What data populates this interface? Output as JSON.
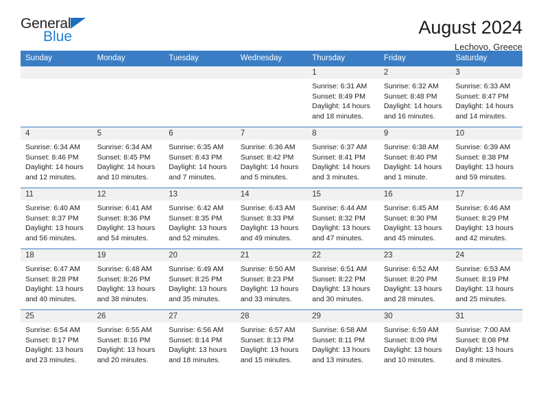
{
  "brand": {
    "word1": "General",
    "word2": "Blue",
    "flag_color": "#1f6fc0",
    "blue_color": "#1f7fd4"
  },
  "header": {
    "title": "August 2024",
    "subtitle": "Lechovo, Greece"
  },
  "theme": {
    "header_blue": "#3b7dc4",
    "daynum_band": "#f1f1f1",
    "text": "#222222"
  },
  "weekday_headers": [
    "Sunday",
    "Monday",
    "Tuesday",
    "Wednesday",
    "Thursday",
    "Friday",
    "Saturday"
  ],
  "weeks": [
    [
      {
        "day": "",
        "empty": true
      },
      {
        "day": "",
        "empty": true
      },
      {
        "day": "",
        "empty": true
      },
      {
        "day": "",
        "empty": true
      },
      {
        "day": "1",
        "sunrise": "Sunrise: 6:31 AM",
        "sunset": "Sunset: 8:49 PM",
        "daylight1": "Daylight: 14 hours",
        "daylight2": "and 18 minutes."
      },
      {
        "day": "2",
        "sunrise": "Sunrise: 6:32 AM",
        "sunset": "Sunset: 8:48 PM",
        "daylight1": "Daylight: 14 hours",
        "daylight2": "and 16 minutes."
      },
      {
        "day": "3",
        "sunrise": "Sunrise: 6:33 AM",
        "sunset": "Sunset: 8:47 PM",
        "daylight1": "Daylight: 14 hours",
        "daylight2": "and 14 minutes."
      }
    ],
    [
      {
        "day": "4",
        "sunrise": "Sunrise: 6:34 AM",
        "sunset": "Sunset: 8:46 PM",
        "daylight1": "Daylight: 14 hours",
        "daylight2": "and 12 minutes."
      },
      {
        "day": "5",
        "sunrise": "Sunrise: 6:34 AM",
        "sunset": "Sunset: 8:45 PM",
        "daylight1": "Daylight: 14 hours",
        "daylight2": "and 10 minutes."
      },
      {
        "day": "6",
        "sunrise": "Sunrise: 6:35 AM",
        "sunset": "Sunset: 8:43 PM",
        "daylight1": "Daylight: 14 hours",
        "daylight2": "and 7 minutes."
      },
      {
        "day": "7",
        "sunrise": "Sunrise: 6:36 AM",
        "sunset": "Sunset: 8:42 PM",
        "daylight1": "Daylight: 14 hours",
        "daylight2": "and 5 minutes."
      },
      {
        "day": "8",
        "sunrise": "Sunrise: 6:37 AM",
        "sunset": "Sunset: 8:41 PM",
        "daylight1": "Daylight: 14 hours",
        "daylight2": "and 3 minutes."
      },
      {
        "day": "9",
        "sunrise": "Sunrise: 6:38 AM",
        "sunset": "Sunset: 8:40 PM",
        "daylight1": "Daylight: 14 hours",
        "daylight2": "and 1 minute."
      },
      {
        "day": "10",
        "sunrise": "Sunrise: 6:39 AM",
        "sunset": "Sunset: 8:38 PM",
        "daylight1": "Daylight: 13 hours",
        "daylight2": "and 59 minutes."
      }
    ],
    [
      {
        "day": "11",
        "sunrise": "Sunrise: 6:40 AM",
        "sunset": "Sunset: 8:37 PM",
        "daylight1": "Daylight: 13 hours",
        "daylight2": "and 56 minutes."
      },
      {
        "day": "12",
        "sunrise": "Sunrise: 6:41 AM",
        "sunset": "Sunset: 8:36 PM",
        "daylight1": "Daylight: 13 hours",
        "daylight2": "and 54 minutes."
      },
      {
        "day": "13",
        "sunrise": "Sunrise: 6:42 AM",
        "sunset": "Sunset: 8:35 PM",
        "daylight1": "Daylight: 13 hours",
        "daylight2": "and 52 minutes."
      },
      {
        "day": "14",
        "sunrise": "Sunrise: 6:43 AM",
        "sunset": "Sunset: 8:33 PM",
        "daylight1": "Daylight: 13 hours",
        "daylight2": "and 49 minutes."
      },
      {
        "day": "15",
        "sunrise": "Sunrise: 6:44 AM",
        "sunset": "Sunset: 8:32 PM",
        "daylight1": "Daylight: 13 hours",
        "daylight2": "and 47 minutes."
      },
      {
        "day": "16",
        "sunrise": "Sunrise: 6:45 AM",
        "sunset": "Sunset: 8:30 PM",
        "daylight1": "Daylight: 13 hours",
        "daylight2": "and 45 minutes."
      },
      {
        "day": "17",
        "sunrise": "Sunrise: 6:46 AM",
        "sunset": "Sunset: 8:29 PM",
        "daylight1": "Daylight: 13 hours",
        "daylight2": "and 42 minutes."
      }
    ],
    [
      {
        "day": "18",
        "sunrise": "Sunrise: 6:47 AM",
        "sunset": "Sunset: 8:28 PM",
        "daylight1": "Daylight: 13 hours",
        "daylight2": "and 40 minutes."
      },
      {
        "day": "19",
        "sunrise": "Sunrise: 6:48 AM",
        "sunset": "Sunset: 8:26 PM",
        "daylight1": "Daylight: 13 hours",
        "daylight2": "and 38 minutes."
      },
      {
        "day": "20",
        "sunrise": "Sunrise: 6:49 AM",
        "sunset": "Sunset: 8:25 PM",
        "daylight1": "Daylight: 13 hours",
        "daylight2": "and 35 minutes."
      },
      {
        "day": "21",
        "sunrise": "Sunrise: 6:50 AM",
        "sunset": "Sunset: 8:23 PM",
        "daylight1": "Daylight: 13 hours",
        "daylight2": "and 33 minutes."
      },
      {
        "day": "22",
        "sunrise": "Sunrise: 6:51 AM",
        "sunset": "Sunset: 8:22 PM",
        "daylight1": "Daylight: 13 hours",
        "daylight2": "and 30 minutes."
      },
      {
        "day": "23",
        "sunrise": "Sunrise: 6:52 AM",
        "sunset": "Sunset: 8:20 PM",
        "daylight1": "Daylight: 13 hours",
        "daylight2": "and 28 minutes."
      },
      {
        "day": "24",
        "sunrise": "Sunrise: 6:53 AM",
        "sunset": "Sunset: 8:19 PM",
        "daylight1": "Daylight: 13 hours",
        "daylight2": "and 25 minutes."
      }
    ],
    [
      {
        "day": "25",
        "sunrise": "Sunrise: 6:54 AM",
        "sunset": "Sunset: 8:17 PM",
        "daylight1": "Daylight: 13 hours",
        "daylight2": "and 23 minutes."
      },
      {
        "day": "26",
        "sunrise": "Sunrise: 6:55 AM",
        "sunset": "Sunset: 8:16 PM",
        "daylight1": "Daylight: 13 hours",
        "daylight2": "and 20 minutes."
      },
      {
        "day": "27",
        "sunrise": "Sunrise: 6:56 AM",
        "sunset": "Sunset: 8:14 PM",
        "daylight1": "Daylight: 13 hours",
        "daylight2": "and 18 minutes."
      },
      {
        "day": "28",
        "sunrise": "Sunrise: 6:57 AM",
        "sunset": "Sunset: 8:13 PM",
        "daylight1": "Daylight: 13 hours",
        "daylight2": "and 15 minutes."
      },
      {
        "day": "29",
        "sunrise": "Sunrise: 6:58 AM",
        "sunset": "Sunset: 8:11 PM",
        "daylight1": "Daylight: 13 hours",
        "daylight2": "and 13 minutes."
      },
      {
        "day": "30",
        "sunrise": "Sunrise: 6:59 AM",
        "sunset": "Sunset: 8:09 PM",
        "daylight1": "Daylight: 13 hours",
        "daylight2": "and 10 minutes."
      },
      {
        "day": "31",
        "sunrise": "Sunrise: 7:00 AM",
        "sunset": "Sunset: 8:08 PM",
        "daylight1": "Daylight: 13 hours",
        "daylight2": "and 8 minutes."
      }
    ]
  ]
}
